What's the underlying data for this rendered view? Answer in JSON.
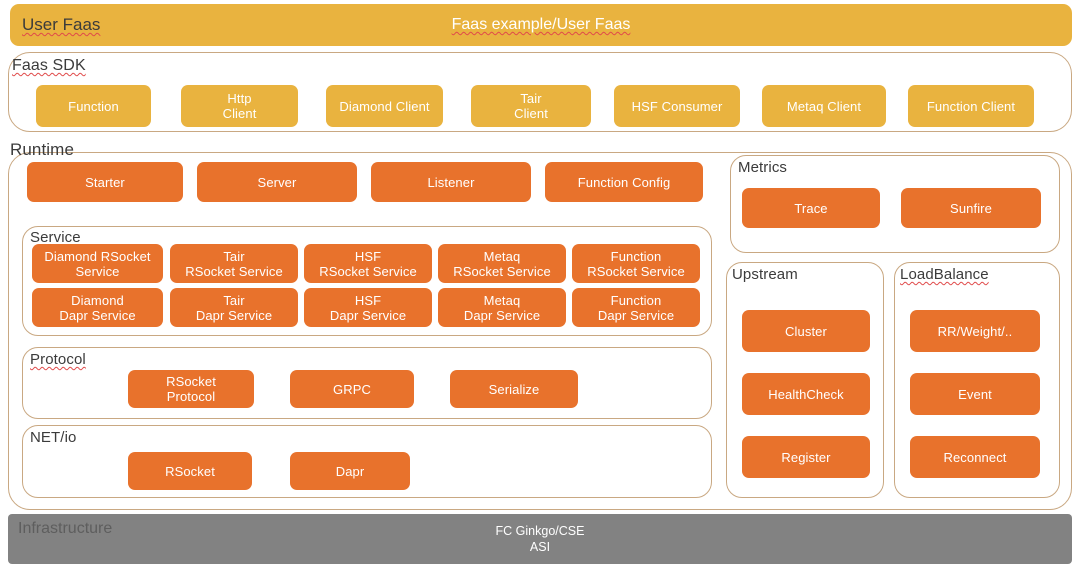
{
  "header": {
    "left_label": "User Faas",
    "center_label": "Faas example/User Faas"
  },
  "sdk": {
    "label": "Faas SDK",
    "items": [
      {
        "label": "Function"
      },
      {
        "label": "Http\nClient"
      },
      {
        "label": "Diamond Client"
      },
      {
        "label": "Tair\nClient"
      },
      {
        "label": "HSF Consumer"
      },
      {
        "label": "Metaq Client"
      },
      {
        "label": "Function Client"
      }
    ]
  },
  "runtime": {
    "label": "Runtime",
    "core_items": [
      {
        "label": "Starter"
      },
      {
        "label": "Server"
      },
      {
        "label": "Listener"
      },
      {
        "label": "Function Config"
      }
    ],
    "service": {
      "label": "Service",
      "rsocket_items": [
        {
          "label": "Diamond RSocket\nService"
        },
        {
          "label": "Tair\nRSocket Service"
        },
        {
          "label": "HSF\nRSocket Service"
        },
        {
          "label": "Metaq\nRSocket Service"
        },
        {
          "label": "Function\nRSocket Service"
        }
      ],
      "dapr_items": [
        {
          "label": "Diamond\nDapr Service"
        },
        {
          "label": "Tair\nDapr Service"
        },
        {
          "label": "HSF\nDapr Service"
        },
        {
          "label": "Metaq\nDapr Service"
        },
        {
          "label": "Function\nDapr Service"
        }
      ]
    },
    "protocol": {
      "label": "Protocol",
      "items": [
        {
          "label": "RSocket\nProtocol"
        },
        {
          "label": "GRPC"
        },
        {
          "label": "Serialize"
        }
      ]
    },
    "netio": {
      "label": "NET/io",
      "items": [
        {
          "label": "RSocket"
        },
        {
          "label": "Dapr"
        }
      ]
    },
    "metrics": {
      "label": "Metrics",
      "items": [
        {
          "label": "Trace"
        },
        {
          "label": "Sunfire"
        }
      ]
    },
    "upstream": {
      "label": "Upstream",
      "items": [
        {
          "label": "Cluster"
        },
        {
          "label": "HealthCheck"
        },
        {
          "label": "Register"
        }
      ]
    },
    "loadbalance": {
      "label": "LoadBalance",
      "items": [
        {
          "label": "RR/Weight/.."
        },
        {
          "label": "Event"
        },
        {
          "label": "Reconnect"
        }
      ]
    }
  },
  "infrastructure": {
    "label": "Infrastructure",
    "center_label": "FC Ginkgo/CSE\nASI"
  },
  "colors": {
    "amber": "#e9b33f",
    "orange": "#e8722c",
    "panel_border": "#c9a882",
    "infra_gray": "#828282",
    "text_dark": "#3b3b3b",
    "white": "#ffffff"
  }
}
